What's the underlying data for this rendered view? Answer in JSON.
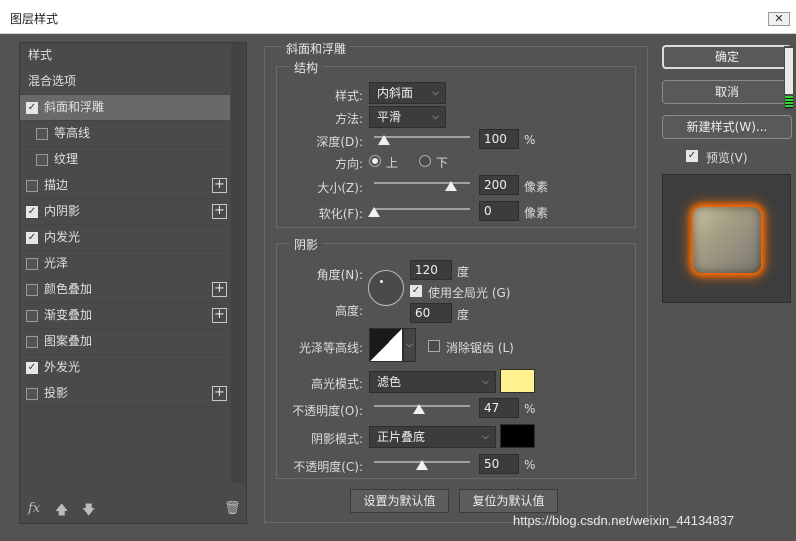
{
  "window": {
    "title": "图层样式",
    "close": "✕"
  },
  "left": {
    "header_styles": "样式",
    "header_blend": "混合选项",
    "items": [
      {
        "label": "斜面和浮雕",
        "checked": true,
        "selected": true
      },
      {
        "label": "等高线",
        "checked": false
      },
      {
        "label": "纹理",
        "checked": false
      },
      {
        "label": "描边",
        "checked": false,
        "plus": true
      },
      {
        "label": "内阴影",
        "checked": true,
        "plus": true
      },
      {
        "label": "内发光",
        "checked": true
      },
      {
        "label": "光泽",
        "checked": false
      },
      {
        "label": "颜色叠加",
        "checked": false,
        "plus": true
      },
      {
        "label": "渐变叠加",
        "checked": false,
        "plus": true
      },
      {
        "label": "图案叠加",
        "checked": false
      },
      {
        "label": "外发光",
        "checked": true
      },
      {
        "label": "投影",
        "checked": false,
        "plus": true
      }
    ],
    "footer": {
      "fx": "fx",
      "trash": "🗑"
    }
  },
  "bevel": {
    "title": "斜面和浮雕",
    "structure": {
      "title": "结构",
      "style_label": "样式:",
      "style_value": "内斜面",
      "technique_label": "方法:",
      "technique_value": "平滑",
      "depth_label": "深度(D):",
      "depth_value": "100",
      "depth_unit": "%",
      "depth_level": 0.1,
      "direction_label": "方向:",
      "dir_up": "上",
      "dir_down": "下",
      "size_label": "大小(Z):",
      "size_value": "200",
      "size_unit": "像素",
      "size_level": 0.8,
      "soften_label": "软化(F):",
      "soften_value": "0",
      "soften_unit": "像素",
      "soften_level": 0.0
    },
    "shading": {
      "title": "阴影",
      "angle_label": "角度(N):",
      "angle_value": "120",
      "angle_unit": "度",
      "global_light_label": "使用全局光 (G)",
      "altitude_label": "高度:",
      "altitude_value": "60",
      "altitude_unit": "度",
      "gloss_label": "光泽等高线:",
      "antialias_label": "消除锯齿 (L)",
      "highlight_mode_label": "高光模式:",
      "highlight_mode_value": "滤色",
      "highlight_color": "#fff28f",
      "highlight_opacity_label": "不透明度(O):",
      "highlight_opacity_value": "47",
      "highlight_opacity_unit": "%",
      "highlight_opacity_level": 0.47,
      "shadow_mode_label": "阴影模式:",
      "shadow_mode_value": "正片叠底",
      "shadow_color": "#000000",
      "shadow_opacity_label": "不透明度(C):",
      "shadow_opacity_value": "50",
      "shadow_opacity_unit": "%",
      "shadow_opacity_level": 0.5
    },
    "btn_set_default": "设置为默认值",
    "btn_reset_default": "复位为默认值"
  },
  "right": {
    "ok": "确定",
    "cancel": "取消",
    "new_style": "新建样式(W)...",
    "preview_label": "预览(V)"
  },
  "watermark": "https://blog.csdn.net/weixin_44134837"
}
